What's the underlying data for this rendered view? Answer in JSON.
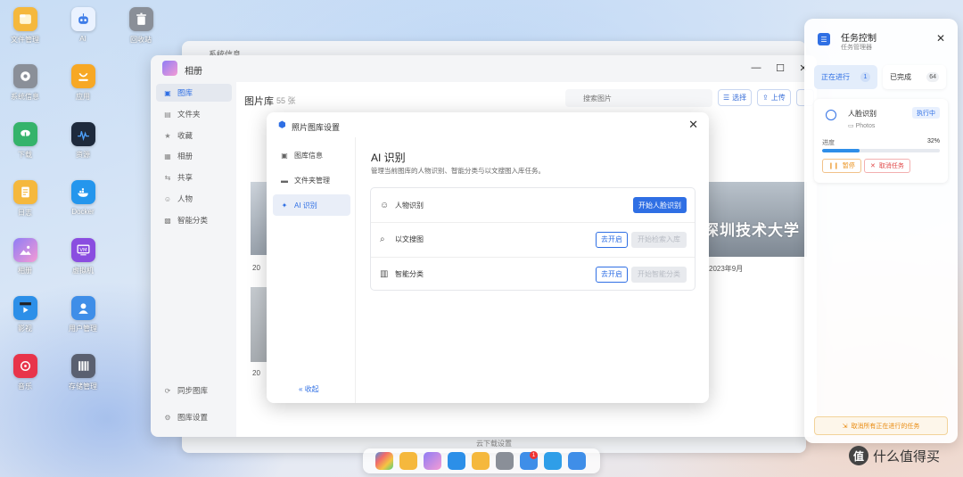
{
  "desktop": {
    "icons": [
      {
        "label": "文件管理",
        "icon": "folder-icon",
        "color": "#f5b83d"
      },
      {
        "label": "AI",
        "icon": "robot-icon",
        "color": "#3f7de8"
      },
      {
        "label": "回收站",
        "icon": "trash-icon",
        "color": "#8a8f98"
      },
      {
        "label": "系统信息",
        "icon": "gear-icon",
        "color": "#8a8f98"
      },
      {
        "label": "应用",
        "icon": "store-icon",
        "color": "#f7a825"
      },
      {
        "label": "下载",
        "icon": "cloud-download-icon",
        "color": "#35b36b"
      },
      {
        "label": "资源",
        "icon": "monitor-icon",
        "color": "#1e2a3c"
      },
      {
        "label": "日志",
        "icon": "notebook-icon",
        "color": "#f5b83d"
      },
      {
        "label": "Docker",
        "icon": "docker-icon",
        "color": "#2496ed"
      },
      {
        "label": "相册",
        "icon": "photo-icon",
        "color": "#8f7cf5"
      },
      {
        "label": "虚拟机",
        "icon": "vm-icon",
        "color": "#8a4de0"
      },
      {
        "label": "影视",
        "icon": "video-icon",
        "color": "#2c8fe8"
      },
      {
        "label": "用户管理",
        "icon": "user-icon",
        "color": "#3f8ee8"
      },
      {
        "label": "音乐",
        "icon": "music-icon",
        "color": "#e8344a"
      },
      {
        "label": "存储管理",
        "icon": "storage-icon",
        "color": "#5a6070"
      }
    ]
  },
  "window": {
    "title": "相册",
    "background_window_title": "系统信息",
    "background_window_footer": "云下载设置"
  },
  "sidebar": {
    "items": [
      {
        "label": "图库",
        "icon": "▣"
      },
      {
        "label": "文件夹",
        "icon": "▤"
      },
      {
        "label": "收藏",
        "icon": "★"
      },
      {
        "label": "相册",
        "icon": "▦"
      },
      {
        "label": "共享",
        "icon": "⇆"
      },
      {
        "label": "人物",
        "icon": "☺"
      },
      {
        "label": "智能分类",
        "icon": "▩"
      }
    ],
    "bottom_items": [
      {
        "label": "同步图库",
        "icon": "⟳"
      },
      {
        "label": "图库设置",
        "icon": "⚙"
      }
    ]
  },
  "library": {
    "title": "图片库",
    "count": "55 张",
    "search_placeholder": "搜索图片",
    "select_label": "选择",
    "upload_label": "上传",
    "date_left_1": "20",
    "date_left_2": "20",
    "date_right": "2023年9月",
    "thumb_text": "深圳技术大学"
  },
  "dialog": {
    "title": "照片图库设置",
    "nav": [
      {
        "label": "图库信息",
        "icon": "▣"
      },
      {
        "label": "文件夹管理",
        "icon": "▬"
      },
      {
        "label": "AI 识别",
        "icon": "✦"
      }
    ],
    "collapse_label": "收起",
    "section_title": "AI 识别",
    "section_desc": "管理当前图库的人物识别、智能分类与以文搜图入库任务。",
    "features": [
      {
        "name": "人物识别",
        "icon": "☺",
        "primary_label": "开始人脸识别"
      },
      {
        "name": "以文搜图",
        "icon": "⌕",
        "enable_label": "去开启",
        "disabled_label": "开始检索入库"
      },
      {
        "name": "智能分类",
        "icon": "▥",
        "enable_label": "去开启",
        "disabled_label": "开始智能分类"
      }
    ]
  },
  "task_panel": {
    "title": "任务控制",
    "subtitle": "任务管理器",
    "tabs": [
      {
        "label": "正在进行",
        "count": "1"
      },
      {
        "label": "已完成",
        "count": "64"
      }
    ],
    "task": {
      "name": "人脸识别",
      "status": "执行中",
      "path": "Photos",
      "progress_label": "进度",
      "progress_text": "32%",
      "progress": 0.32,
      "pause_label": "暂停",
      "cancel_label": "取消任务"
    },
    "cancel_all_label": "取消所有正在进行的任务"
  },
  "watermark": {
    "logo_char": "值",
    "text": "什么值得买"
  },
  "colors": {
    "accent": "#2f6fe4",
    "warning": "#e98b10",
    "danger": "#e04747"
  }
}
